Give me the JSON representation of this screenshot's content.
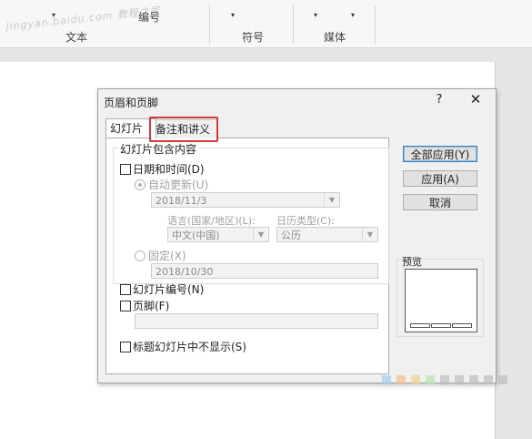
{
  "ribbon": {
    "group_labels": [
      "文本",
      "符号",
      "媒体"
    ],
    "numbering_label": "编号",
    "dropdown_marker": "▾"
  },
  "watermark": "jingyan.baidu.com 教程之家",
  "dialog": {
    "title": "页眉和页脚",
    "help": "?",
    "close": "✕",
    "tabs": [
      {
        "label": "幻灯片",
        "active": true
      },
      {
        "label": "备注和讲义",
        "active": false,
        "highlighted": true
      }
    ],
    "group_title": "幻灯片包含内容",
    "date_time": {
      "label": "日期和时间(D)",
      "checked": false
    },
    "auto_update": {
      "label": "自动更新(U)",
      "selected": true,
      "value": "2018/11/3"
    },
    "language_label": "语言(国家/地区)(L):",
    "language_value": "中文(中国)",
    "calendar_label": "日历类型(C):",
    "calendar_value": "公历",
    "fixed": {
      "label": "固定(X)",
      "selected": false,
      "value": "2018/10/30"
    },
    "slide_number": {
      "label": "幻灯片编号(N)",
      "checked": false
    },
    "footer": {
      "label": "页脚(F)",
      "checked": false,
      "value": ""
    },
    "hide_title": {
      "label": "标题幻灯片中不显示(S)",
      "checked": false
    },
    "buttons": {
      "apply_all": "全部应用(Y)",
      "apply": "应用(A)",
      "cancel": "取消"
    },
    "preview_label": "预览"
  },
  "colors": {
    "highlight": "#d23a3a",
    "default_button_border": "#3c7fb1"
  }
}
